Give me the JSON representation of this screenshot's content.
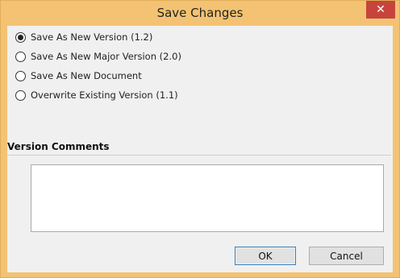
{
  "window": {
    "title": "Save Changes",
    "close_label": "✕"
  },
  "options": [
    {
      "label": "Save As New Version (1.2)",
      "checked": true
    },
    {
      "label": "Save As New Major Version (2.0)",
      "checked": false
    },
    {
      "label": "Save As New Document",
      "checked": false
    },
    {
      "label": "Overwrite Existing Version (1.1)",
      "checked": false
    }
  ],
  "comments": {
    "label": "Version Comments",
    "value": ""
  },
  "buttons": {
    "ok_label": "OK",
    "cancel_label": "Cancel"
  },
  "colors": {
    "frame": "#f3c373",
    "close": "#c7443c",
    "client": "#f0f0f0"
  }
}
